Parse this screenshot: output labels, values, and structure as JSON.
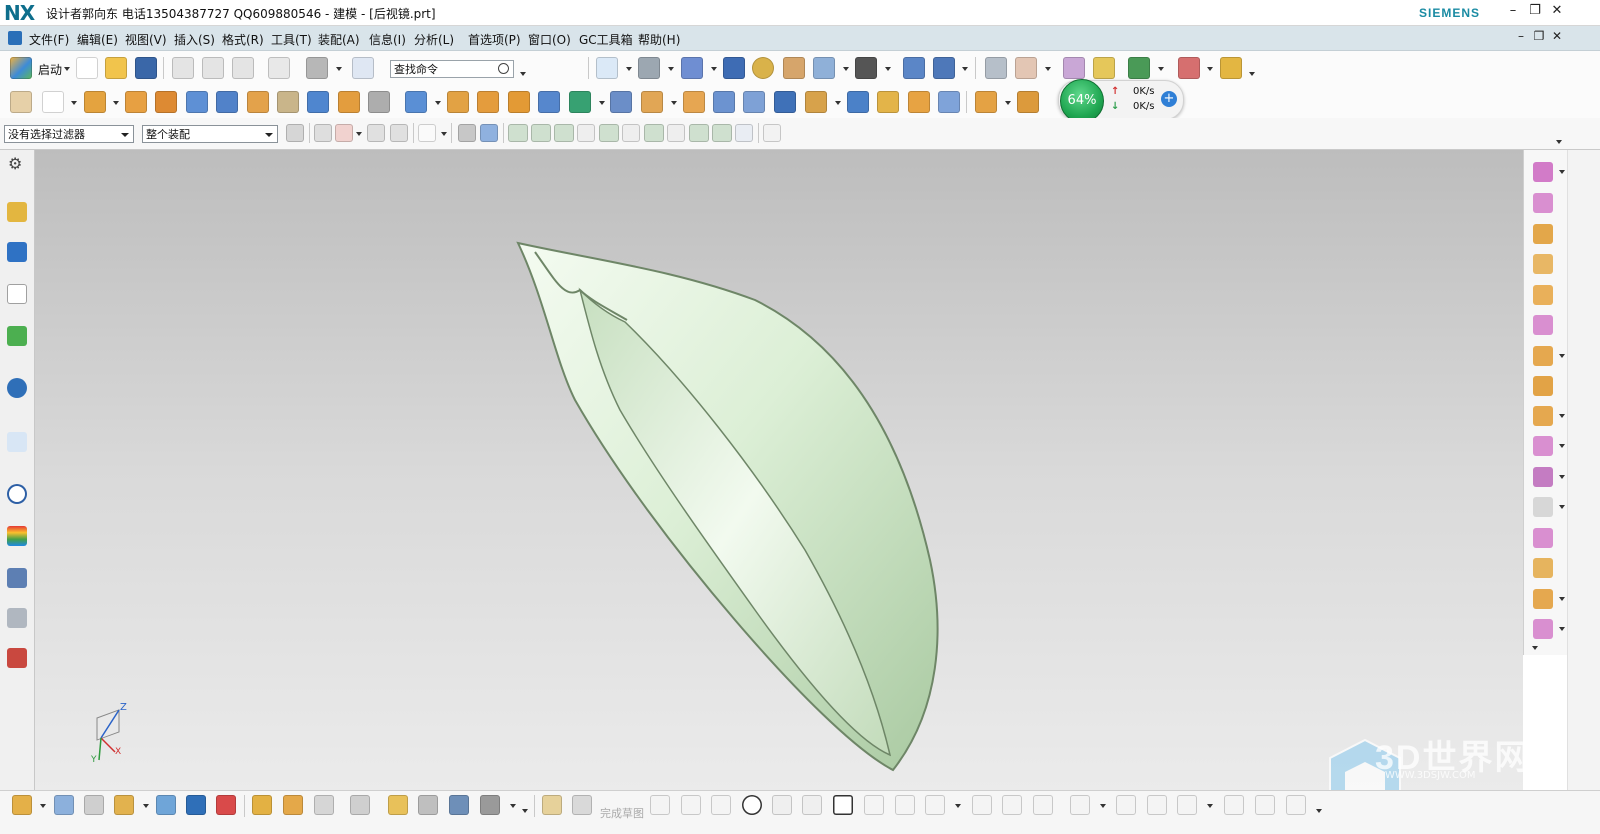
{
  "window": {
    "logo": "NX",
    "title": "设计者郭向东  电话13504387727  QQ609880546 - 建模 - [后视镜.prt]",
    "brand": "SIEMENS",
    "controls": [
      "–",
      "❐",
      "✕"
    ]
  },
  "menu": {
    "items": [
      "文件(F)",
      "编辑(E)",
      "视图(V)",
      "插入(S)",
      "格式(R)",
      "工具(T)",
      "装配(A)",
      "信息(I)",
      "分析(L)",
      "首选项(P)",
      "窗口(O)",
      "GC工具箱",
      "帮助(H)"
    ],
    "controls": [
      "–",
      "❐",
      "✕"
    ]
  },
  "toolbar": {
    "start_label": "启动",
    "search_placeholder": "查找命令",
    "selection_filter": "没有选择过滤器",
    "scope": "整个装配"
  },
  "net_widget": {
    "percent": "64%",
    "up_rate": "0K/s",
    "down_rate": "0K/s"
  },
  "bottom_toolbar": {
    "finish_sketch": "完成草图"
  },
  "watermark": {
    "text": "3D世界网",
    "url": "WWW.3DSJW.COM"
  },
  "colors": {
    "menubar_bg": "#d9e4ea",
    "viewport_top": "#bdbdbd",
    "viewport_bottom": "#ebebeb",
    "model_surface": "#d8ecd2",
    "model_edge": "#6e8667",
    "brand": "#1a8ba3",
    "net_ball": "#1fa651"
  },
  "viewport": {
    "triad_labels": [
      "Z",
      "X",
      "Y"
    ]
  }
}
